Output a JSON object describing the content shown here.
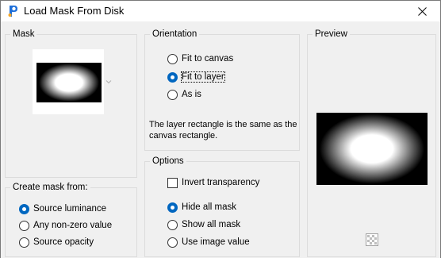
{
  "window": {
    "title": "Load Mask From Disk",
    "app_icon": "paint-shop-icon",
    "close_icon": "close-icon"
  },
  "mask": {
    "legend": "Mask",
    "thumbnail": "radial-gradient-mask"
  },
  "create_from": {
    "legend": "Create mask from:",
    "options": [
      {
        "label": "Source luminance",
        "checked": true
      },
      {
        "label": "Any non-zero value",
        "checked": false
      },
      {
        "label": "Source opacity",
        "checked": false
      }
    ]
  },
  "orientation": {
    "legend": "Orientation",
    "options": [
      {
        "label": "Fit to canvas",
        "checked": false
      },
      {
        "label": "Fit to layer",
        "checked": true
      },
      {
        "label": "As is",
        "checked": false
      }
    ],
    "info": "The layer rectangle is the same as the canvas rectangle."
  },
  "options": {
    "legend": "Options",
    "invert_label": "Invert transparency",
    "invert_checked": false,
    "radios": [
      {
        "label": "Hide all mask",
        "checked": true
      },
      {
        "label": "Show all mask",
        "checked": false
      },
      {
        "label": "Use image value",
        "checked": false
      }
    ]
  },
  "preview": {
    "legend": "Preview",
    "checker_icon": "transparency-checker-icon"
  }
}
